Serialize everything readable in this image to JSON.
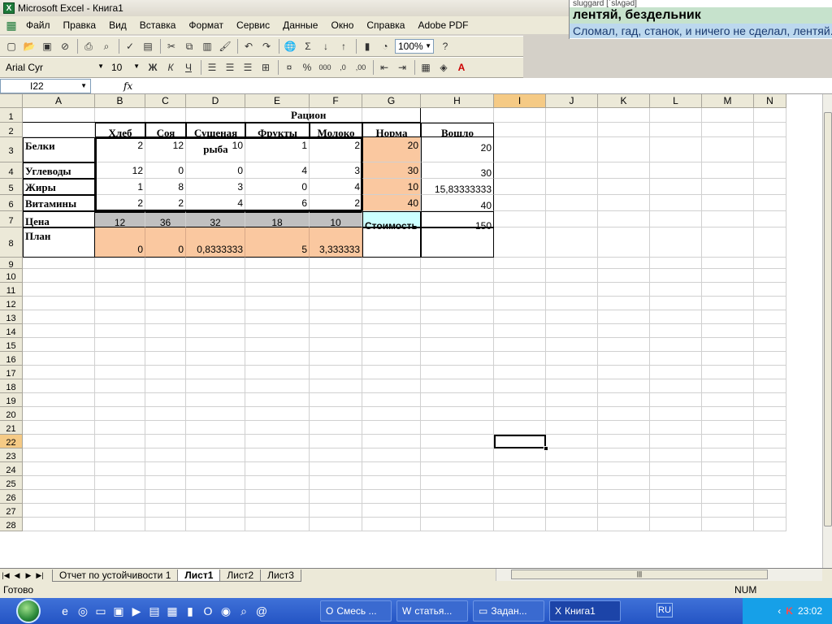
{
  "window": {
    "title": "Microsoft Excel - Книга1"
  },
  "dictionary": {
    "word": "sluggard [ˈslʌgəd]",
    "translation": "лентяй, бездельник",
    "example": "Сломал, гад, станок, и ничего не сделал, лентяй..."
  },
  "menu": [
    "Файл",
    "Правка",
    "Вид",
    "Вставка",
    "Формат",
    "Сервис",
    "Данные",
    "Окно",
    "Справка",
    "Adobe PDF"
  ],
  "toolbar": {
    "zoom": "100%",
    "font_name": "Arial Cyr",
    "font_size": "10"
  },
  "formula_bar": {
    "name_box": "I22",
    "fx": "fx",
    "formula": ""
  },
  "columns": [
    "A",
    "B",
    "C",
    "D",
    "E",
    "F",
    "G",
    "H",
    "I",
    "J",
    "K",
    "L",
    "M",
    "N"
  ],
  "rows": [
    "1",
    "2",
    "3",
    "4",
    "5",
    "6",
    "7",
    "8",
    "9",
    "10",
    "11",
    "12",
    "13",
    "14",
    "15",
    "16",
    "17",
    "18",
    "19",
    "20",
    "21",
    "22",
    "23",
    "24",
    "25",
    "26",
    "27",
    "28"
  ],
  "sheet": {
    "title": "Рацион",
    "headers": [
      "Хлеб",
      "Соя",
      "Сушеная рыба",
      "Фрукты",
      "Молоко",
      "Норма",
      "Вошло"
    ],
    "nutrients": [
      {
        "name": "Белки",
        "values": [
          "2",
          "12",
          "10",
          "1",
          "2"
        ],
        "norm": "20",
        "got": "20"
      },
      {
        "name": "Углеводы",
        "values": [
          "12",
          "0",
          "0",
          "4",
          "3"
        ],
        "norm": "30",
        "got": "30"
      },
      {
        "name": "Жиры",
        "values": [
          "1",
          "8",
          "3",
          "0",
          "4"
        ],
        "norm": "10",
        "got": "15,83333333"
      },
      {
        "name": "Витамины",
        "values": [
          "2",
          "2",
          "4",
          "6",
          "2"
        ],
        "norm": "40",
        "got": "40"
      }
    ],
    "price_label": "Цена",
    "prices": [
      "12",
      "36",
      "32",
      "18",
      "10"
    ],
    "cost_label": "Стоимость",
    "cost_value": "150",
    "plan_label": "План",
    "plan": [
      "0",
      "0",
      "0,8333333",
      "5",
      "3,333333"
    ]
  },
  "sheet_tabs": [
    "Отчет по устойчивости 1",
    "Лист1",
    "Лист2",
    "Лист3"
  ],
  "active_tab": "Лист1",
  "status": {
    "left": "Готово",
    "right": "NUM"
  },
  "taskbar": {
    "tasks": [
      "Смесь ...",
      "статья...",
      "Задан...",
      "Книга1"
    ],
    "lang": "RU",
    "clock": "23:02"
  },
  "colors": {
    "peach": "#fac8a0",
    "gray": "#c0c0c0",
    "cyan": "#ccffff",
    "active_col": "#f5ca85"
  }
}
